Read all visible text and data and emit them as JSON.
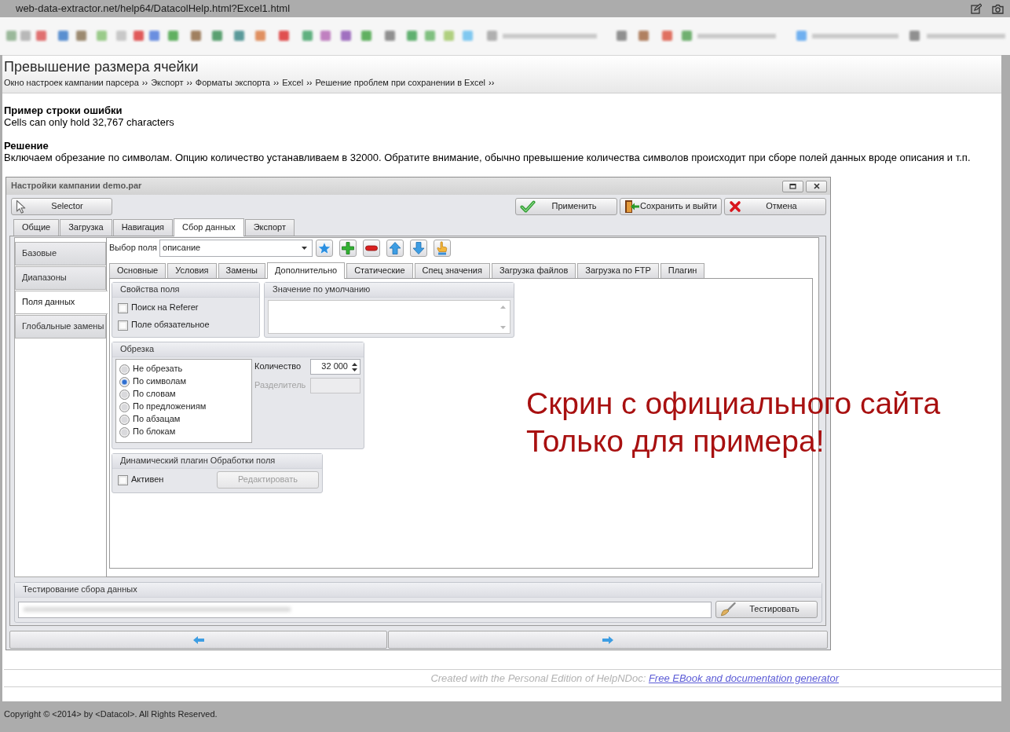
{
  "browser": {
    "url": "web-data-extractor.net/help64/DatacolHelp.html?Excel1.html"
  },
  "header": {
    "title": "Превышение размера ячейки",
    "breadcrumbs": [
      {
        "label": "Окно настроек кампании парсера",
        "separator": "››"
      },
      {
        "label": "Экспорт",
        "separator": "››"
      },
      {
        "label": "Форматы экспорта",
        "separator": "››"
      },
      {
        "label": "Excel",
        "separator": "››"
      },
      {
        "label": "Решение проблем при сохранении в Excel",
        "separator": "››"
      }
    ]
  },
  "content": [
    {
      "kind": "heading",
      "text": "Пример строки ошибки"
    },
    {
      "kind": "paragraph",
      "text": "Cells can only hold 32,767 characters"
    },
    {
      "kind": "heading",
      "text": "Решение"
    },
    {
      "kind": "paragraph",
      "text": "Включаем обрезание по символам. Опцию количество устанавливаем в 32000. Обратите внимание, обычно превышение количества символов происходит при сборе полей данных вроде описания и т.п."
    }
  ],
  "app_window": {
    "title": "Настройки кампании demo.par",
    "selector_button": "Selector",
    "actions": [
      {
        "kind": "apply",
        "label": "Применить"
      },
      {
        "kind": "save_exit",
        "label": "Сохранить и выйти"
      },
      {
        "kind": "cancel",
        "label": "Отмена"
      }
    ],
    "tabs": [
      {
        "label": "Общие",
        "selected": false
      },
      {
        "label": "Загрузка",
        "selected": false
      },
      {
        "label": "Навигация",
        "selected": false
      },
      {
        "label": "Сбор данных",
        "selected": true
      },
      {
        "label": "Экспорт",
        "selected": false
      }
    ],
    "side_tabs": [
      {
        "label": "Базовые",
        "selected": false
      },
      {
        "label": "Диапазоны",
        "selected": false
      },
      {
        "label": "Поля данных",
        "selected": true
      },
      {
        "label": "Глобальные замены",
        "selected": false
      }
    ],
    "field_select": {
      "label": "Выбор поля",
      "value": "описание"
    },
    "sub_tabs": [
      {
        "label": "Основные",
        "selected": false
      },
      {
        "label": "Условия",
        "selected": false
      },
      {
        "label": "Замены",
        "selected": false
      },
      {
        "label": "Дополнительно",
        "selected": true
      },
      {
        "label": "Статические",
        "selected": false
      },
      {
        "label": "Спец значения",
        "selected": false
      },
      {
        "label": "Загрузка файлов",
        "selected": false
      },
      {
        "label": "Загрузка по FTP",
        "selected": false
      },
      {
        "label": "Плагин",
        "selected": false
      }
    ],
    "field_properties": {
      "title": "Свойства поля",
      "options": [
        {
          "label": "Поиск на Referer",
          "checked": false
        },
        {
          "label": "Поле обязательное",
          "checked": false
        }
      ]
    },
    "default_value": {
      "title": "Значение по умолчанию"
    },
    "trimming": {
      "title": "Обрезка",
      "modes": [
        {
          "label": "Не обрезать",
          "selected": false
        },
        {
          "label": "По символам",
          "selected": true
        },
        {
          "label": "По словам",
          "selected": false
        },
        {
          "label": "По предложениям",
          "selected": false
        },
        {
          "label": "По абзацам",
          "selected": false
        },
        {
          "label": "По блокам",
          "selected": false
        }
      ],
      "count": {
        "label": "Количество",
        "value": "32 000"
      },
      "separator": {
        "label": "Разделитель",
        "disabled": true
      }
    },
    "plugin": {
      "title": "Динамический плагин Обработки поля",
      "active": {
        "label": "Активен",
        "checked": false
      },
      "edit_button": {
        "label": "Редактировать",
        "disabled": true
      }
    },
    "testing": {
      "title": "Тестирование сбора данных",
      "button": "Тестировать"
    }
  },
  "annotation": [
    "Скрин с официального сайта",
    "Только для примера!"
  ],
  "footer": {
    "credit": "Created with the Personal Edition of HelpNDoc:",
    "link": "Free EBook and documentation generator"
  },
  "copyright": "Copyright © <2014> by <Datacol>. All Rights Reserved."
}
